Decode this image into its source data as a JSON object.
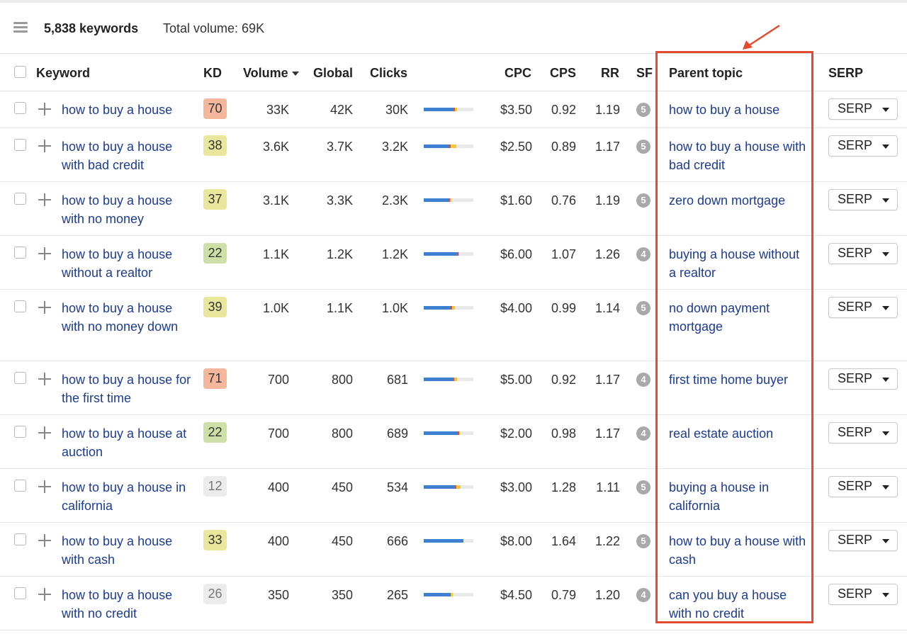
{
  "toolbar": {
    "keyword_count": "5,838 keywords",
    "total_volume": "Total volume: 69K"
  },
  "columns": {
    "keyword": "Keyword",
    "kd": "KD",
    "volume": "Volume",
    "global": "Global",
    "clicks": "Clicks",
    "cpc": "CPC",
    "cps": "CPS",
    "rr": "RR",
    "sf": "SF",
    "parent_topic": "Parent topic",
    "serp": "SERP"
  },
  "colors": {
    "kd_hard": "#f4b79c",
    "kd_medium": "#e9e79c",
    "kd_easy": "#cde0a8",
    "kd_very_easy": "#ececec",
    "link": "#1d3c8e",
    "highlight": "#e34a2f",
    "clicks_organic": "#3d7fd0",
    "clicks_paid": "#d24d4d",
    "clicks_other": "#f0c63b"
  },
  "icons": {
    "menu": "hamburger-icon",
    "add": "plus-icon",
    "sort": "sort-down-icon",
    "dropdown": "caret-down-icon",
    "annotation": "red-arrow"
  },
  "rows": [
    {
      "keyword": "how to buy a house",
      "kd": "70",
      "kd_level": "hard",
      "volume": "33K",
      "global": "42K",
      "clicks": "30K",
      "clicks_bar": {
        "organic": 0.6,
        "paid": 0.03,
        "other": 0.04
      },
      "cpc": "$3.50",
      "cps": "0.92",
      "rr": "1.19",
      "sf": "5",
      "parent_topic": "how to buy a house",
      "serp": "SERP"
    },
    {
      "keyword": "how to buy a house with bad credit",
      "kd": "38",
      "kd_level": "medium",
      "volume": "3.6K",
      "global": "3.7K",
      "clicks": "3.2K",
      "clicks_bar": {
        "organic": 0.52,
        "paid": 0.03,
        "other": 0.11
      },
      "cpc": "$2.50",
      "cps": "0.89",
      "rr": "1.17",
      "sf": "5",
      "parent_topic": "how to buy a house with bad credit",
      "serp": "SERP"
    },
    {
      "keyword": "how to buy a house with no money",
      "kd": "37",
      "kd_level": "medium",
      "volume": "3.1K",
      "global": "3.3K",
      "clicks": "2.3K",
      "clicks_bar": {
        "organic": 0.51,
        "paid": 0.02,
        "other": 0.03
      },
      "cpc": "$1.60",
      "cps": "0.76",
      "rr": "1.19",
      "sf": "5",
      "parent_topic": "zero down mortgage",
      "serp": "SERP"
    },
    {
      "keyword": "how to buy a house without a realtor",
      "kd": "22",
      "kd_level": "easy",
      "volume": "1.1K",
      "global": "1.2K",
      "clicks": "1.2K",
      "clicks_bar": {
        "organic": 0.69,
        "paid": 0.02,
        "other": 0.01
      },
      "cpc": "$6.00",
      "cps": "1.07",
      "rr": "1.26",
      "sf": "4",
      "parent_topic": "buying a house without a realtor",
      "serp": "SERP"
    },
    {
      "keyword": "how to buy a house with no money down",
      "kd": "39",
      "kd_level": "medium",
      "volume": "1.0K",
      "global": "1.1K",
      "clicks": "1.0K",
      "clicks_bar": {
        "organic": 0.54,
        "paid": 0.03,
        "other": 0.06
      },
      "cpc": "$4.00",
      "cps": "0.99",
      "rr": "1.14",
      "sf": "5",
      "parent_topic": "no down payment mortgage",
      "serp": "SERP"
    },
    {
      "keyword": "how to buy a house for the first time",
      "kd": "71",
      "kd_level": "hard",
      "volume": "700",
      "global": "800",
      "clicks": "681",
      "clicks_bar": {
        "organic": 0.6,
        "paid": 0.02,
        "other": 0.05
      },
      "cpc": "$5.00",
      "cps": "0.92",
      "rr": "1.17",
      "sf": "4",
      "parent_topic": "first time home buyer",
      "serp": "SERP"
    },
    {
      "keyword": "how to buy a house at auction",
      "kd": "22",
      "kd_level": "easy",
      "volume": "700",
      "global": "800",
      "clicks": "689",
      "clicks_bar": {
        "organic": 0.69,
        "paid": 0.03,
        "other": 0.01
      },
      "cpc": "$2.00",
      "cps": "0.98",
      "rr": "1.17",
      "sf": "4",
      "parent_topic": "real estate auction",
      "serp": "SERP"
    },
    {
      "keyword": "how to buy a house in california",
      "kd": "12",
      "kd_level": "very_easy",
      "volume": "400",
      "global": "450",
      "clicks": "534",
      "clicks_bar": {
        "organic": 0.63,
        "paid": 0.03,
        "other": 0.09
      },
      "cpc": "$3.00",
      "cps": "1.28",
      "rr": "1.11",
      "sf": "5",
      "parent_topic": "buying a house in california",
      "serp": "SERP"
    },
    {
      "keyword": "how to buy a house with cash",
      "kd": "33",
      "kd_level": "medium",
      "volume": "400",
      "global": "450",
      "clicks": "666",
      "clicks_bar": {
        "organic": 0.8,
        "paid": 0.0,
        "other": 0.0
      },
      "cpc": "$8.00",
      "cps": "1.64",
      "rr": "1.22",
      "sf": "5",
      "parent_topic": "how to buy a house with cash",
      "serp": "SERP"
    },
    {
      "keyword": "how to buy a house with no credit",
      "kd": "26",
      "kd_level": "very_easy",
      "volume": "350",
      "global": "350",
      "clicks": "265",
      "clicks_bar": {
        "organic": 0.53,
        "paid": 0.02,
        "other": 0.04
      },
      "cpc": "$4.50",
      "cps": "0.79",
      "rr": "1.20",
      "sf": "4",
      "parent_topic": "can you buy a house with no credit",
      "serp": "SERP"
    }
  ]
}
